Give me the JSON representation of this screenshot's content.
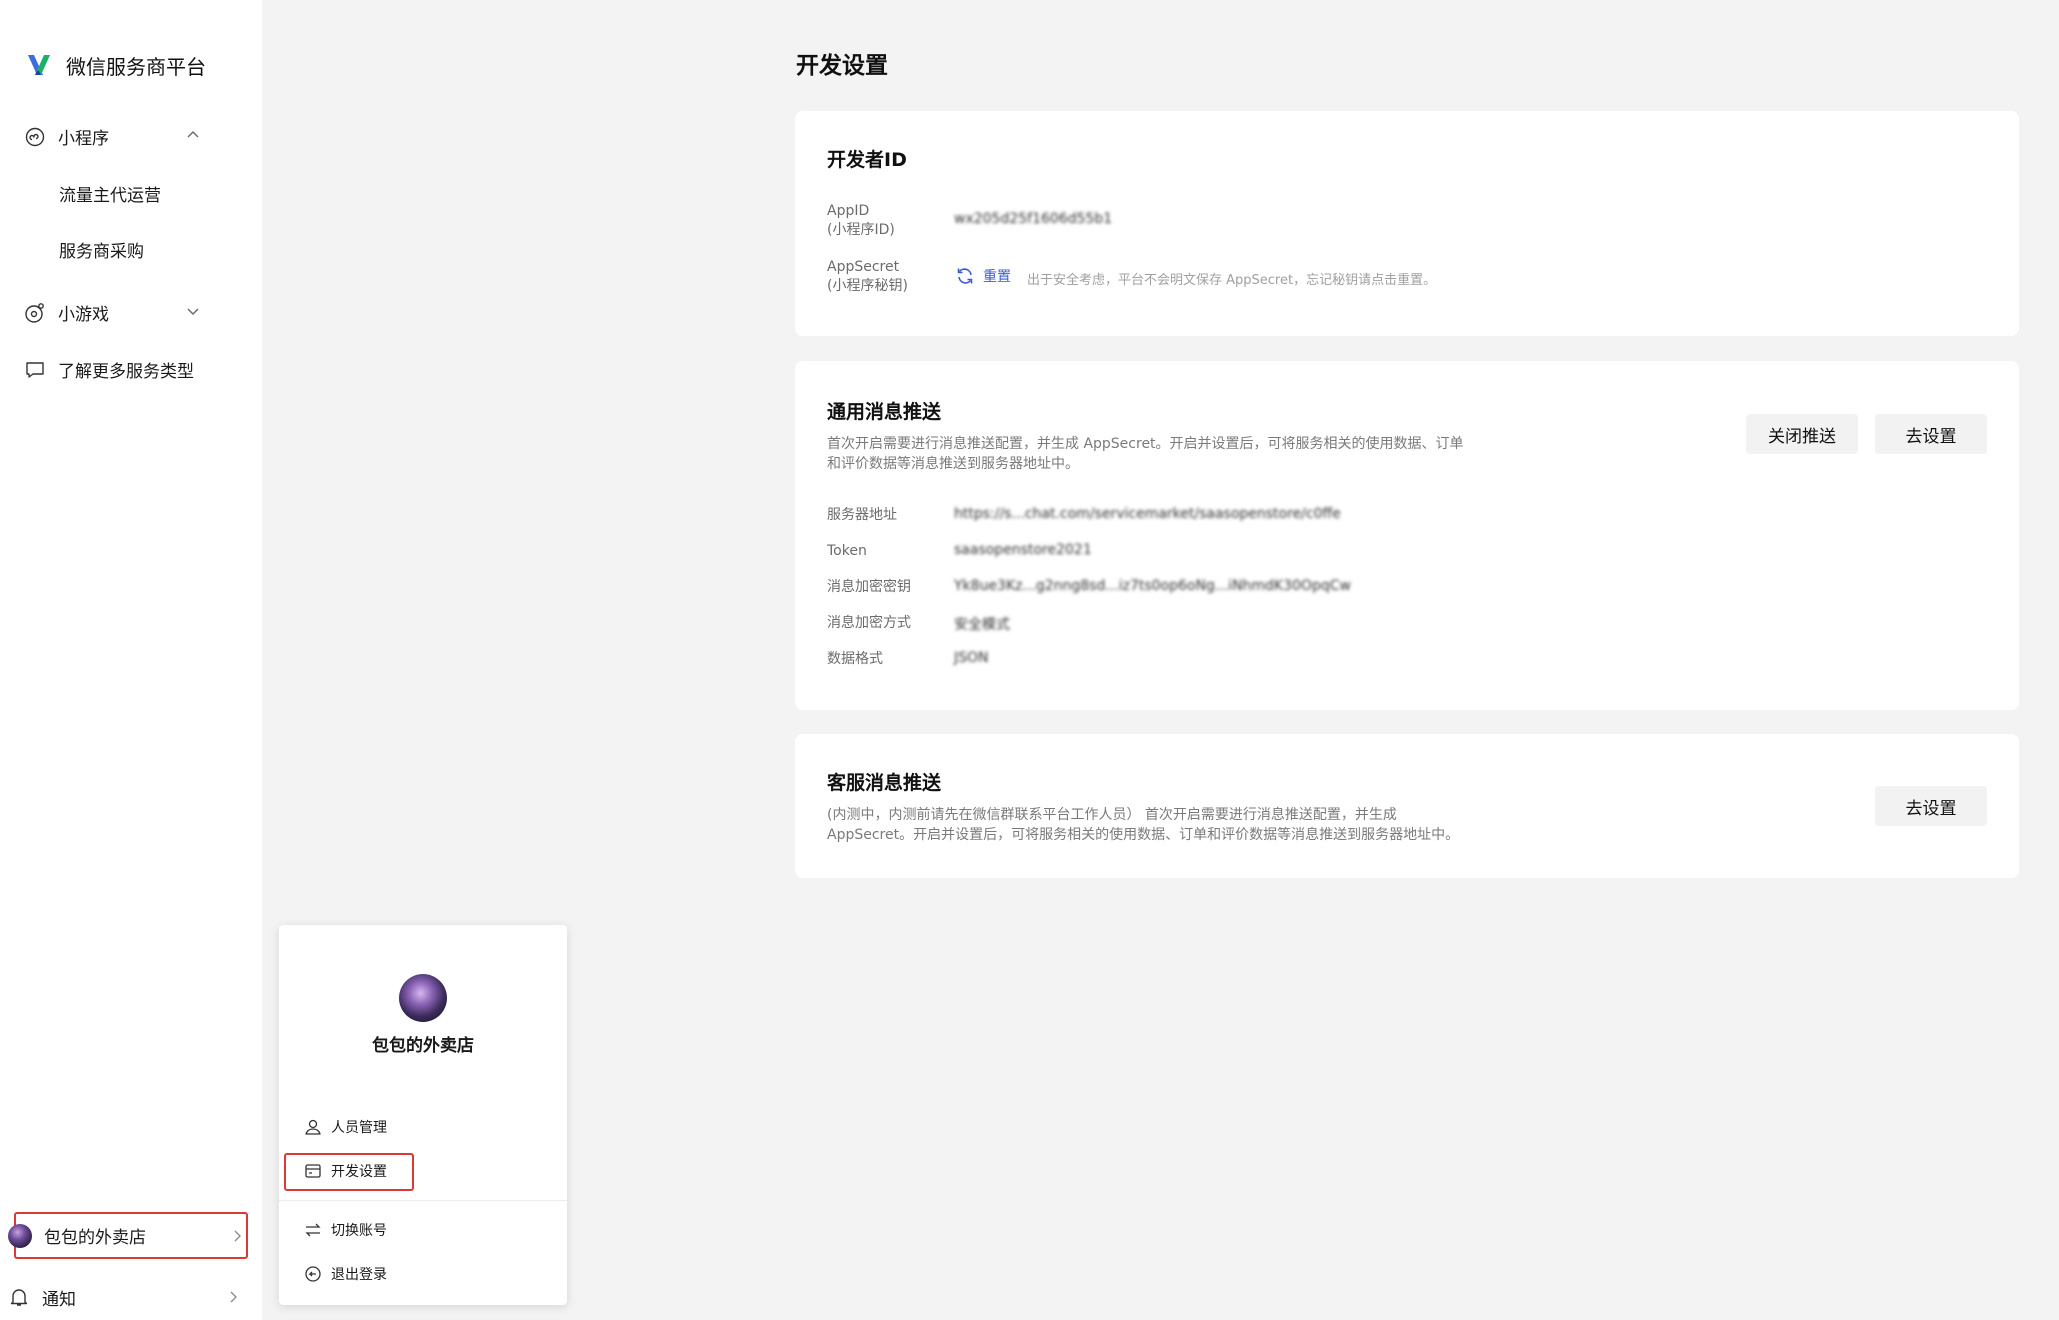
{
  "brand": {
    "name": "微信服务商平台",
    "logo": "wechat-service-logo"
  },
  "sidebar": {
    "miniprogram": {
      "label": "小程序",
      "icon": "miniprogram-icon",
      "expanded": true,
      "children": [
        "流量主代运营",
        "服务商采购"
      ]
    },
    "minigame": {
      "label": "小游戏",
      "icon": "minigame-icon",
      "expanded": false
    },
    "more": {
      "label": "了解更多服务类型",
      "icon": "chat-bubble-icon"
    },
    "account": {
      "name": "包包的外卖店"
    },
    "notify": {
      "label": "通知",
      "icon": "bell-icon"
    }
  },
  "popup": {
    "name": "包包的外卖店",
    "items": [
      {
        "label": "人员管理",
        "icon": "user-icon"
      },
      {
        "label": "开发设置",
        "icon": "dev-settings-icon"
      },
      {
        "label": "切换账号",
        "icon": "switch-icon"
      },
      {
        "label": "退出登录",
        "icon": "logout-icon"
      }
    ]
  },
  "main": {
    "title": "开发设置",
    "developer": {
      "title": "开发者ID",
      "appid_label_1": "AppID",
      "appid_label_2": "(小程序ID)",
      "appid_value": "wx205d25f1606d55b1",
      "secret_label_1": "AppSecret",
      "secret_label_2": "(小程序秘钥)",
      "reset_label": "重置",
      "secret_hint": "出于安全考虑，平台不会明文保存 AppSecret，忘记秘钥请点击重置。"
    },
    "push": {
      "title": "通用消息推送",
      "desc_1": "首次开启需要进行消息推送配置，并生成 AppSecret。开启并设置后，可将服务相关的使用数据、订单",
      "desc_2": "和评价数据等消息推送到服务器地址中。",
      "close_btn": "关闭推送",
      "setup_btn": "去设置",
      "fields": [
        {
          "label": "服务器地址",
          "value": "https://s...chat.com/servicemarket/saasopenstore/c0ffe"
        },
        {
          "label": "Token",
          "value": "saasopenstore2021"
        },
        {
          "label": "消息加密密钥",
          "value": "Yk8ue3Kz...g2nng8sd...iz7ts0op6oNg...iNhmdK30OpqCw"
        },
        {
          "label": "消息加密方式",
          "value": "安全模式"
        },
        {
          "label": "数据格式",
          "value": "JSON"
        }
      ]
    },
    "kefu": {
      "title": "客服消息推送",
      "desc_1": "(内测中，内测前请先在微信群联系平台工作人员）  首次开启需要进行消息推送配置，并生成",
      "desc_2": "AppSecret。开启并设置后，可将服务相关的使用数据、订单和评价数据等消息推送到服务器地址中。",
      "setup_btn": "去设置"
    }
  }
}
